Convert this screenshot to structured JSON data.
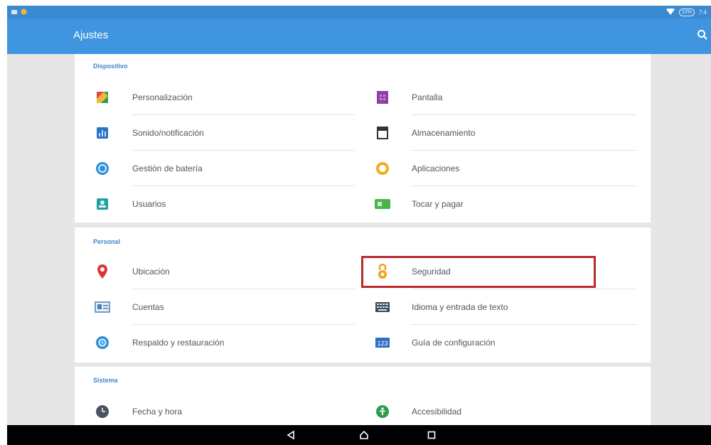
{
  "status_bar": {
    "battery_text": "10%",
    "time_text": "7:4",
    "icons": [
      "sd-card-icon",
      "notification-dot-icon",
      "wifi-icon",
      "battery-icon"
    ]
  },
  "app_bar": {
    "title": "Ajustes",
    "search_icon": "search-icon"
  },
  "sections": [
    {
      "title": "Dispositivo",
      "items": [
        {
          "label": "Personalización",
          "icon": "personalization-icon"
        },
        {
          "label": "Pantalla",
          "icon": "display-icon"
        },
        {
          "label": "Sonido/notificación",
          "icon": "sound-icon"
        },
        {
          "label": "Almacenamiento",
          "icon": "storage-icon"
        },
        {
          "label": "Gestión de batería",
          "icon": "battery-management-icon"
        },
        {
          "label": "Aplicaciones",
          "icon": "apps-icon"
        },
        {
          "label": "Usuarios",
          "icon": "users-icon"
        },
        {
          "label": "Tocar y pagar",
          "icon": "tap-pay-icon"
        }
      ]
    },
    {
      "title": "Personal",
      "items": [
        {
          "label": "Ubicación",
          "icon": "location-icon"
        },
        {
          "label": "Seguridad",
          "icon": "security-lock-icon"
        },
        {
          "label": "Cuentas",
          "icon": "accounts-icon"
        },
        {
          "label": "Idioma y entrada de texto",
          "icon": "keyboard-icon"
        },
        {
          "label": "Respaldo y restauración",
          "icon": "backup-icon"
        },
        {
          "label": "Guía de configuración",
          "icon": "setup-guide-icon"
        }
      ]
    },
    {
      "title": "Sistema",
      "items": [
        {
          "label": "Fecha y hora",
          "icon": "clock-icon"
        },
        {
          "label": "Accesibilidad",
          "icon": "accessibility-icon"
        }
      ]
    }
  ],
  "nav_bar": {
    "back": "back-icon",
    "home": "home-icon",
    "recents": "recents-icon"
  },
  "colors": {
    "app_bar": "#4095e0",
    "status_bar": "#3a8ad0",
    "section_title": "#3f87c8",
    "highlight": "#b82a2f"
  }
}
